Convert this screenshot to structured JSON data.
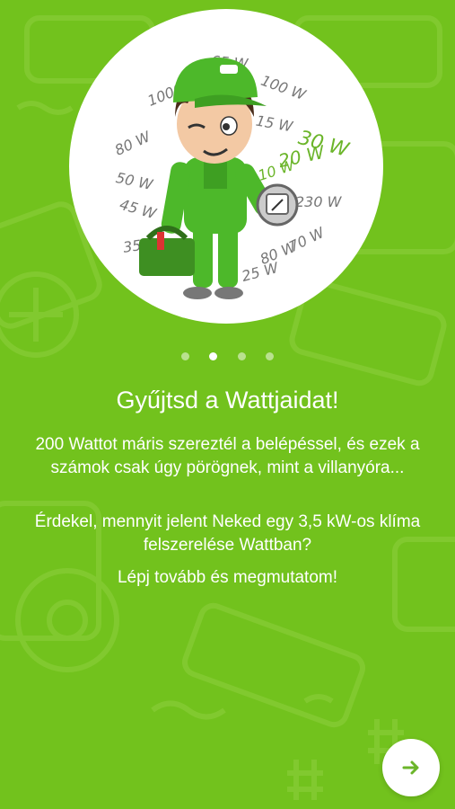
{
  "watt_labels": [
    "1000 W",
    "65 W",
    "100 W",
    "15 W",
    "80 W",
    "30 W",
    "20 W",
    "10 W",
    "50 W",
    "45 W",
    "230 W",
    "35 W",
    "80 W",
    "70 W",
    "25 W"
  ],
  "pager": {
    "count": 4,
    "active_index": 1
  },
  "title": "Gyűjtsd a Wattjaidat!",
  "paragraphs": [
    "200 Wattot máris szereztél a belépéssel, és ezek a számok csak úgy pörögnek, mint a villanyóra...",
    "Érdekel, mennyit jelent Neked egy 3,5 kW-os klíma felszerelése Wattban?",
    "Lépj tovább és megmutatom!"
  ],
  "colors": {
    "background": "#72c21d",
    "accent": "#6bb52a"
  },
  "next_button": {
    "icon": "arrow-right-icon"
  }
}
